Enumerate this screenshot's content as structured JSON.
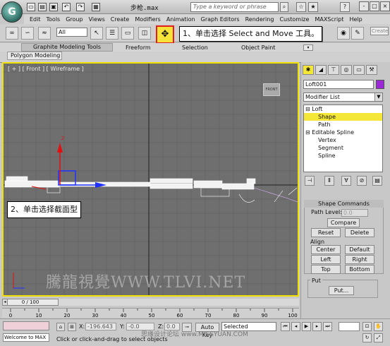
{
  "title_bar": {
    "app_logo": "G",
    "doc_title": "步枪.max",
    "search_placeholder": "Type a keyword or phrase",
    "win_buttons": [
      "-",
      "□",
      "×"
    ]
  },
  "menu": [
    "Edit",
    "Tools",
    "Group",
    "Views",
    "Create",
    "Modifiers",
    "Animation",
    "Graph Editors",
    "Rendering",
    "Customize",
    "MAXScript",
    "Help"
  ],
  "toolbar": {
    "selection_filter": "All",
    "create_selection_set": "Create"
  },
  "callouts": {
    "step1": "1、单击选择 Select and Move 工具。",
    "step2": "2、单击选择截面型"
  },
  "ribbon": {
    "tabs": [
      "Graphite Modeling Tools",
      "Freeform",
      "Selection",
      "Object Paint"
    ],
    "sub_tab": "Polygon Modeling"
  },
  "viewport": {
    "label": "[ + ] [ Front ] [ Wireframe ]",
    "viewcube": "FRONT",
    "gizmo_axis_y": "Z",
    "watermark": "騰龍視覺WWW.TLVI.NET"
  },
  "command_panel": {
    "object_name": "Loft001",
    "object_color": "#9b2ad6",
    "modifier_list": "Modifier List",
    "stack": [
      {
        "label": "⊟ Loft",
        "indent": 0,
        "selected": false
      },
      {
        "label": "Shape",
        "indent": 1,
        "selected": true
      },
      {
        "label": "Path",
        "indent": 1,
        "selected": false
      },
      {
        "label": "⊟ Editable Spline",
        "indent": 0,
        "selected": false
      },
      {
        "label": "Vertex",
        "indent": 1,
        "selected": false
      },
      {
        "label": "Segment",
        "indent": 1,
        "selected": false
      },
      {
        "label": "Spline",
        "indent": 1,
        "selected": false
      }
    ],
    "rollout_title": "Shape Commands",
    "path_level_label": "Path Level:",
    "path_level_value": "0.0",
    "compare_btn": "Compare",
    "reset_btn": "Reset",
    "delete_btn": "Delete",
    "align_label": "Align",
    "align_buttons": [
      "Center",
      "Default",
      "Left",
      "Right",
      "Top",
      "Bottom"
    ],
    "put_label": "Put",
    "put_btn": "Put..."
  },
  "timeline": {
    "slider": "0 / 100",
    "ruler_ticks": [
      "0",
      "10",
      "20",
      "30",
      "40",
      "50",
      "60",
      "70",
      "80",
      "90",
      "100"
    ]
  },
  "status": {
    "welcome": "Welcome to MAX",
    "message": "Click or click-and-drag to select objects",
    "x_label": "X:",
    "x_value": "-196.643",
    "y_label": "Y:",
    "y_value": "-0.0",
    "z_label": "Z:",
    "z_value": "0.0",
    "auto_key": "Auto Key",
    "key_filter": "Selected",
    "credit": "思缘设计论坛 www.MISSYUAN.COM"
  },
  "colors": {
    "viewport_border": "#f0e000",
    "highlight": "#f5e63a",
    "callout_border": "#e02020"
  }
}
